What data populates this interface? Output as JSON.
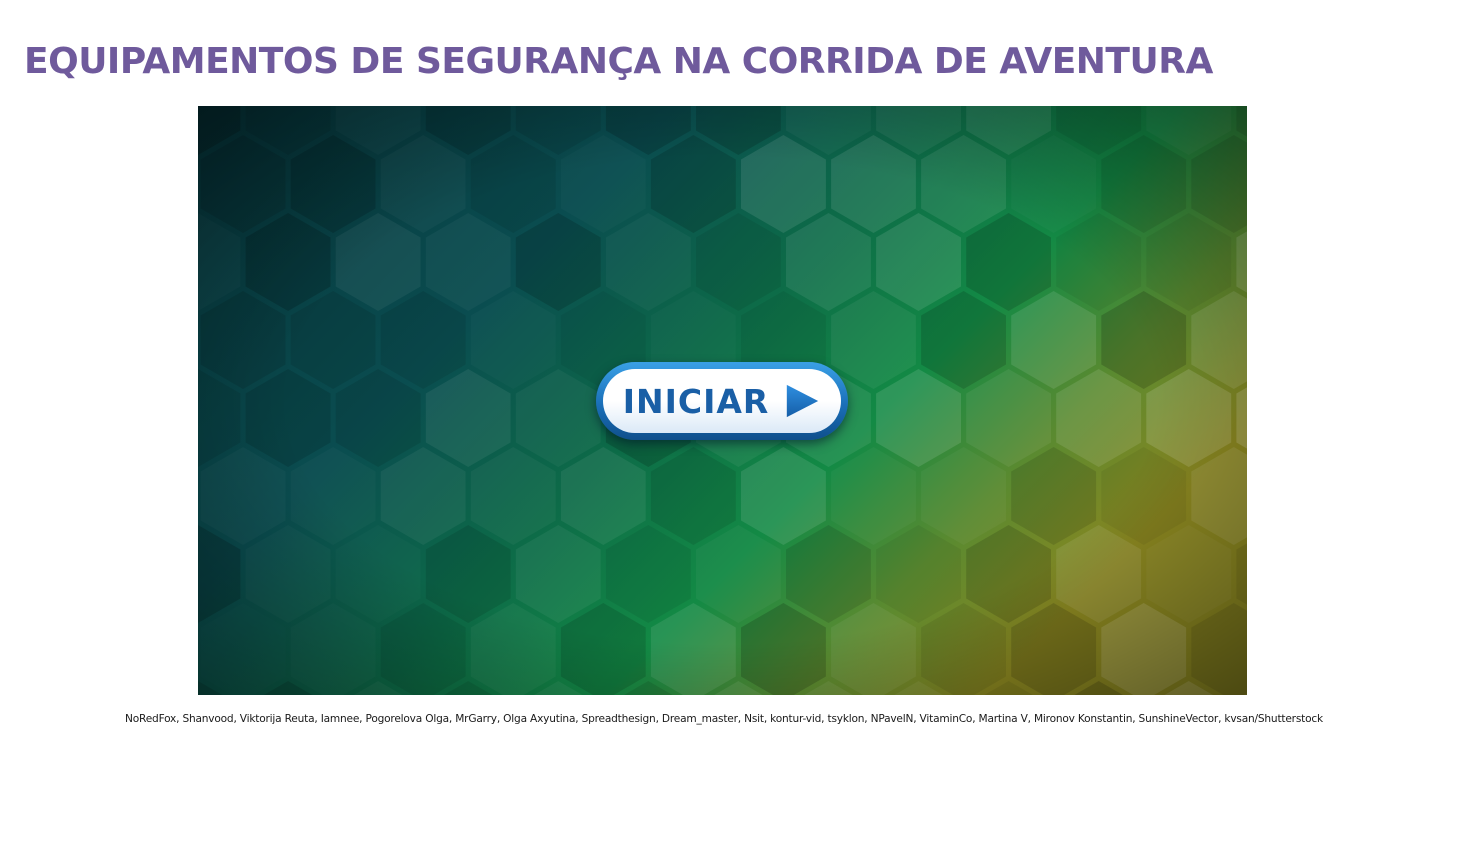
{
  "header": {
    "title": "EQUIPAMENTOS DE SEGURANÇA NA CORRIDA DE AVENTURA"
  },
  "stage": {
    "background": "hexagon-pattern",
    "start_button": {
      "label": "INICIAR",
      "icon": "play-icon"
    }
  },
  "footer": {
    "credits": "NoRedFox, Shanvood, Viktorija Reuta, Iamnee, Pogorelova Olga, MrGarry, Olga Axyutina, Spreadthesign, Dream_master, Nsit, kontur-vid, tsyklon, NPavelN, VitaminCo, Martina V, Mironov Konstantin, SunshineVector, kvsan/Shutterstock"
  },
  "colors": {
    "title": "#6f5a9c",
    "button_text": "#1a5fa6",
    "button_border": "#1a6fb8",
    "bg_dark": "#06343a",
    "bg_green": "#0f8a4a",
    "bg_yellow": "#8e8d24"
  }
}
